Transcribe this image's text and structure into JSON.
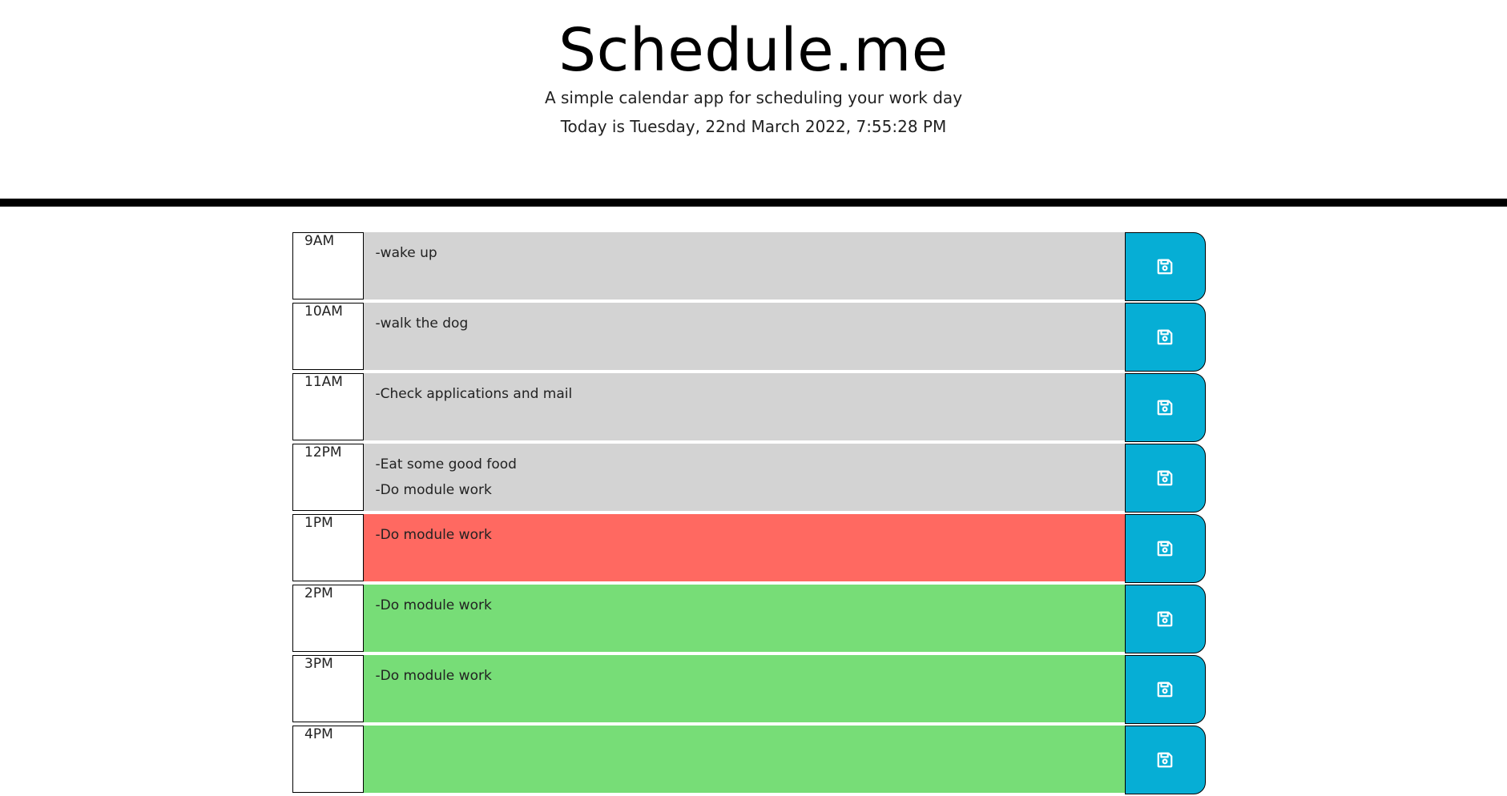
{
  "header": {
    "title": "Schedule.me",
    "lead": "A simple calendar app for scheduling your work day",
    "current_day": "Today is Tuesday, 22nd March 2022, 7:55:28 PM"
  },
  "colors": {
    "past": "#d3d3d3",
    "present": "#ff6961",
    "future": "#77dd77",
    "save_button": "#06aed5"
  },
  "time_blocks": [
    {
      "hour": "9AM",
      "text": "-wake up",
      "status": "past",
      "icon": "save-icon"
    },
    {
      "hour": "10AM",
      "text": "-walk the dog",
      "status": "past",
      "icon": "save-icon"
    },
    {
      "hour": "11AM",
      "text": "-Check applications and mail",
      "status": "past",
      "icon": "save-icon"
    },
    {
      "hour": "12PM",
      "text": "-Eat some good food\n-Do module work",
      "status": "past",
      "icon": "save-icon"
    },
    {
      "hour": "1PM",
      "text": "-Do module work",
      "status": "present",
      "icon": "save-icon"
    },
    {
      "hour": "2PM",
      "text": "-Do module work",
      "status": "future",
      "icon": "save-icon"
    },
    {
      "hour": "3PM",
      "text": "-Do module work",
      "status": "future",
      "icon": "save-icon"
    },
    {
      "hour": "4PM",
      "text": "",
      "status": "future",
      "icon": "save-icon"
    }
  ]
}
